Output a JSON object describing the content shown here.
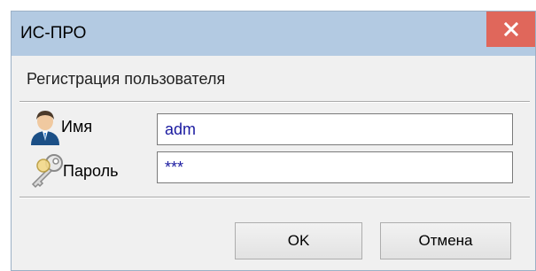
{
  "window": {
    "title": "ИС-ПРО",
    "header": "Регистрация пользователя"
  },
  "form": {
    "name_label": "Имя",
    "name_value": "adm",
    "password_label": "Пароль",
    "password_value": "***"
  },
  "buttons": {
    "ok_label": "OK",
    "cancel_label": "Отмена"
  },
  "icons": {
    "close": "close-icon",
    "user": "user-icon",
    "key": "key-icon"
  },
  "colors": {
    "titlebar": "#b3cae2",
    "close_button": "#e0675b",
    "input_text": "#1a1aa0"
  }
}
